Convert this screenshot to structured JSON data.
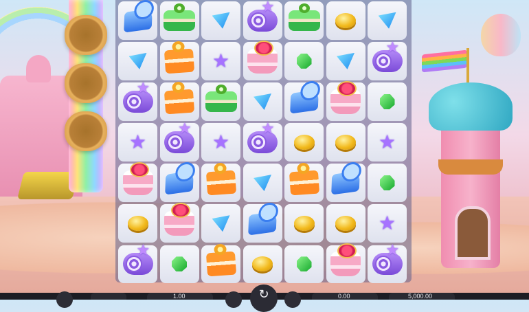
{
  "game": {
    "grid": [
      [
        "blue-cake",
        "green-cake",
        "blue-gem",
        "purple-roll",
        "green-cake",
        "gold-coin",
        "blue-gem"
      ],
      [
        "blue-gem",
        "orange-cake",
        "purple-star",
        "pink-cake",
        "green-gem",
        "blue-gem",
        "purple-roll"
      ],
      [
        "purple-roll",
        "orange-cake",
        "green-cake",
        "blue-gem",
        "blue-cake",
        "pink-cake",
        "green-gem"
      ],
      [
        "purple-star",
        "purple-roll",
        "purple-star",
        "purple-roll",
        "gold-coin",
        "gold-coin",
        "purple-star"
      ],
      [
        "pink-cake",
        "blue-cake",
        "orange-cake",
        "blue-gem",
        "orange-cake",
        "blue-cake",
        "green-gem"
      ],
      [
        "gold-coin",
        "pink-cake",
        "blue-gem",
        "blue-cake",
        "gold-coin",
        "gold-coin",
        "purple-star"
      ],
      [
        "purple-roll",
        "green-gem",
        "orange-cake",
        "gold-coin",
        "green-gem",
        "pink-cake",
        "purple-roll"
      ]
    ],
    "symbol_colors": {
      "blue-cake": "#2c6fe6",
      "green-cake": "#35b64b",
      "orange-cake": "#ff8a22",
      "purple-roll": "#7a4ad8",
      "pink-cake": "#f39abb",
      "blue-gem": "#1c8bf0",
      "green-gem": "#15a82d",
      "purple-star": "#a672ff",
      "gold-coin": "#f2b91c"
    }
  },
  "bottom_bar": {
    "bet_value": "1.00",
    "win_value": "0.00",
    "balance_value": "5,000.00",
    "spin_icon": "refresh-icon"
  }
}
